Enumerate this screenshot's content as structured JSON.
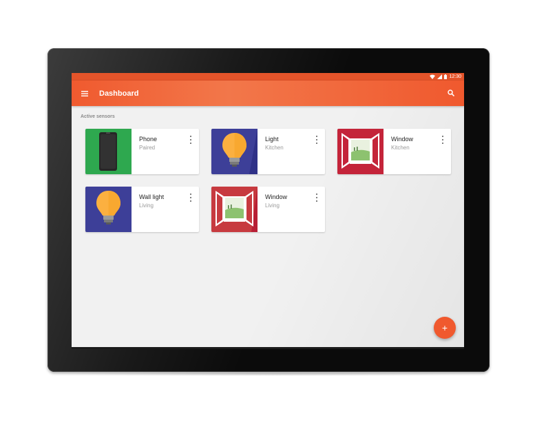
{
  "status_bar": {
    "time": "12:30",
    "icons": [
      "wifi-icon",
      "cell-signal-icon",
      "battery-icon"
    ]
  },
  "app_bar": {
    "title": "Dashboard",
    "menu_icon": "menu-icon",
    "search_icon": "search-icon"
  },
  "section": {
    "label": "Active sensors"
  },
  "cards": [
    {
      "title": "Phone",
      "subtitle": "Paired",
      "icon": "phone-icon",
      "bg": "#2ea84f"
    },
    {
      "title": "Light",
      "subtitle": "Kitchen",
      "icon": "bulb-icon",
      "bg": "#3d3f98"
    },
    {
      "title": "Window",
      "subtitle": "Kitchen",
      "icon": "window-icon",
      "bg": "#c4243a"
    },
    {
      "title": "Wall light",
      "subtitle": "Living",
      "icon": "bulb-icon",
      "bg": "#3d3f98"
    },
    {
      "title": "Window",
      "subtitle": "Living",
      "icon": "window-icon",
      "bg": "#c4243a"
    }
  ],
  "fab": {
    "label": "+",
    "icon": "add-icon"
  },
  "colors": {
    "accent": "#f0592e",
    "status_bar": "#e4542a",
    "background": "#f1f1f1"
  }
}
